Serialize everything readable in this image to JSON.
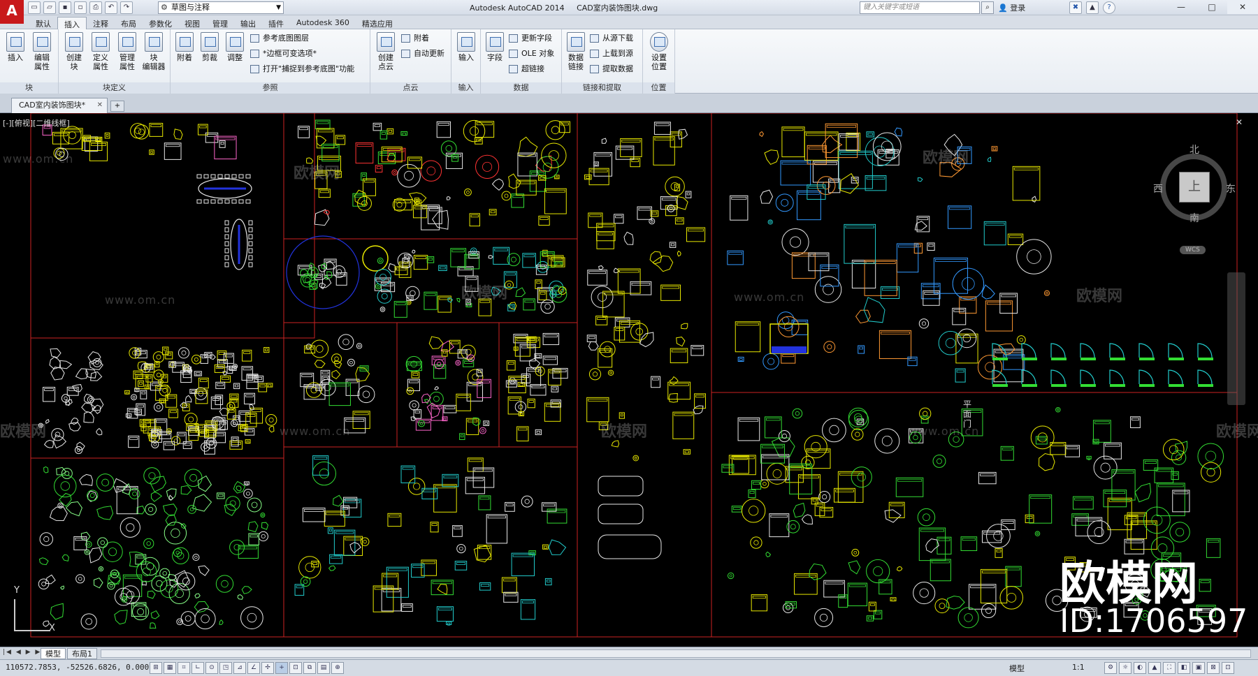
{
  "app": {
    "logo_letter": "A",
    "title": "Autodesk AutoCAD 2014",
    "document": "CAD室内装饰图块.dwg"
  },
  "qat": {
    "workspace": "草图与注释"
  },
  "titlebar": {
    "search_placeholder": "键入关键字或短语",
    "login_label": "登录"
  },
  "ribbon": {
    "tabs": [
      "默认",
      "插入",
      "注释",
      "布局",
      "参数化",
      "视图",
      "管理",
      "输出",
      "插件",
      "Autodesk 360",
      "精选应用"
    ],
    "active_tab": "插入",
    "panels": {
      "block": {
        "title": "块",
        "buttons": [
          "插入",
          "编辑\n属性"
        ]
      },
      "block_def": {
        "title": "块定义",
        "buttons": [
          "创建\n块",
          "定义\n属性",
          "管理\n属性",
          "块\n编辑器"
        ]
      },
      "reference": {
        "title": "参照",
        "buttons": [
          "附着",
          "剪裁",
          "调整"
        ],
        "small": [
          "参考底图图层",
          "*边框可变选项*",
          "打开\"捕捉到参考底图\"功能"
        ]
      },
      "pointcloud": {
        "title": "点云",
        "buttons": [
          "创建\n点云"
        ],
        "small": [
          "附着",
          "自动更新"
        ]
      },
      "import": {
        "title": "输入",
        "buttons": [
          "输入"
        ]
      },
      "data": {
        "title": "数据",
        "buttons": [
          "字段"
        ],
        "small": [
          "更新字段",
          "OLE 对象",
          "超链接"
        ]
      },
      "linking": {
        "title": "链接和提取",
        "buttons": [
          "数据\n链接"
        ],
        "small": [
          "从源下载",
          "上载到源",
          "提取数据"
        ]
      },
      "location": {
        "title": "位置",
        "buttons": [
          "设置\n位置"
        ]
      }
    }
  },
  "doc_tab": {
    "label": "CAD室内装饰图块*"
  },
  "viewport": {
    "label": "[-][俯视][二维线框]",
    "viewcube": {
      "north": "北",
      "south": "南",
      "east": "东",
      "west": "西",
      "face": "上"
    },
    "wcs": "WCS",
    "side_label": "平面门",
    "ucs_y": "Y",
    "ucs_x": "X"
  },
  "watermark": {
    "brand": "欧模网",
    "url": "www.om.cn",
    "id_text": "ID:1706597"
  },
  "layout": {
    "tabs": [
      "模型",
      "布局1"
    ],
    "active": "模型"
  },
  "status": {
    "coords": "110572.7853, -52526.6826, 0.0000",
    "model": "模型",
    "scale": "1:1"
  },
  "colors": {
    "frame": "#cc2222",
    "yellow": "#e8e800",
    "green": "#33dd33",
    "cyan": "#22cccc",
    "white": "#e8e8e8",
    "blue": "#2233dd"
  }
}
